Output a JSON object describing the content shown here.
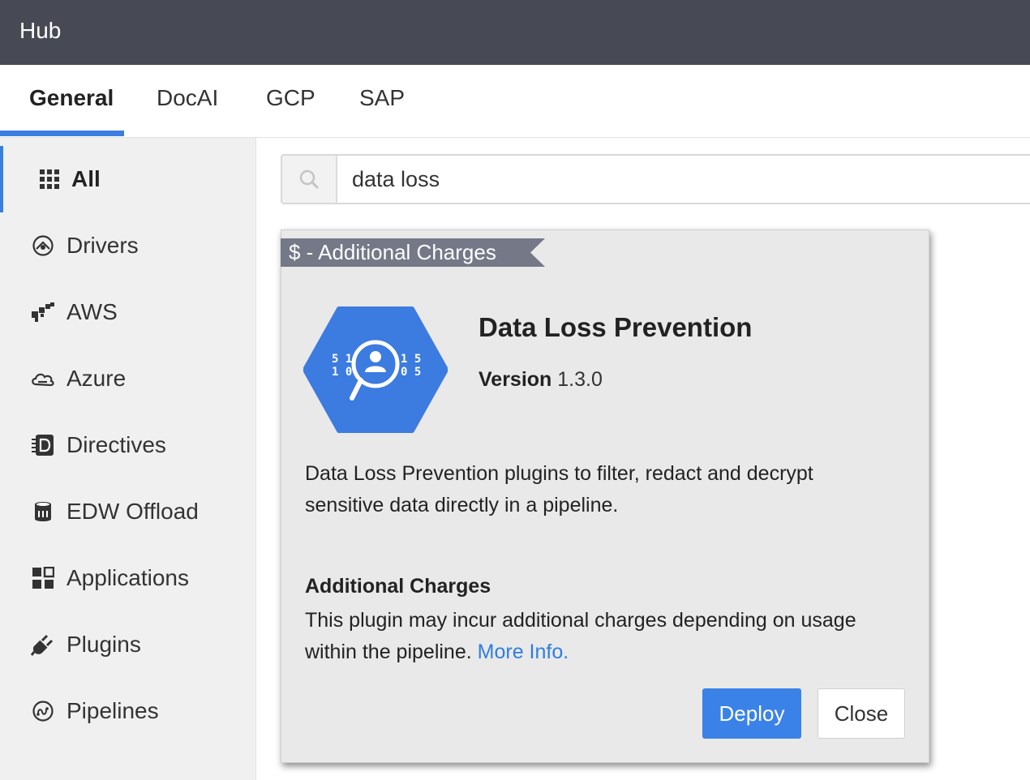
{
  "app": {
    "title": "Hub"
  },
  "tabs": [
    {
      "label": "General",
      "active": true
    },
    {
      "label": "DocAI"
    },
    {
      "label": "GCP"
    },
    {
      "label": "SAP"
    }
  ],
  "sidebar": {
    "items": [
      {
        "label": "All",
        "icon": "grid-icon",
        "active": true
      },
      {
        "label": "Drivers",
        "icon": "driver-icon"
      },
      {
        "label": "AWS",
        "icon": "aws-icon"
      },
      {
        "label": "Azure",
        "icon": "azure-icon"
      },
      {
        "label": "Directives",
        "icon": "directives-icon"
      },
      {
        "label": "EDW Offload",
        "icon": "database-icon"
      },
      {
        "label": "Applications",
        "icon": "applications-icon"
      },
      {
        "label": "Plugins",
        "icon": "plug-icon"
      },
      {
        "label": "Pipelines",
        "icon": "pipeline-icon"
      }
    ]
  },
  "search": {
    "value": "data loss",
    "icon": "search-icon"
  },
  "card": {
    "ribbon": "$ - Additional Charges",
    "logo_digits_left": [
      "5 1",
      "1 0"
    ],
    "logo_digits_right": [
      "1 5",
      "0 5"
    ],
    "title": "Data Loss Prevention",
    "version_label": "Version",
    "version_value": "1.3.0",
    "description": "Data Loss Prevention plugins to filter, redact and decrypt sensitive data directly in a pipeline.",
    "charges_heading": "Additional Charges",
    "charges_text": "This plugin may incur additional charges depending on usage within the pipeline.",
    "more_info": "More Info.",
    "deploy_label": "Deploy",
    "close_label": "Close"
  },
  "colors": {
    "accent": "#3b82e8",
    "titlebar": "#474a55",
    "ribbon": "#747887",
    "logo": "#3c7be0"
  }
}
